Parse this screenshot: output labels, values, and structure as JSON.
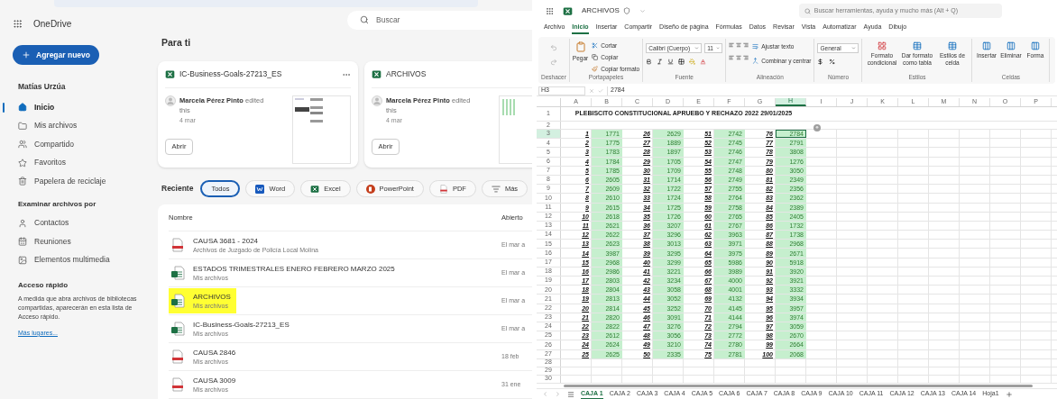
{
  "onedrive": {
    "app_name": "OneDrive",
    "new_button": "Agregar nuevo",
    "user_name": "Matías Urzúa",
    "nav": [
      {
        "label": "Inicio",
        "selected": true
      },
      {
        "label": "Mis archivos",
        "selected": false
      },
      {
        "label": "Compartido",
        "selected": false
      },
      {
        "label": "Favoritos",
        "selected": false
      },
      {
        "label": "Papelera de reciclaje",
        "selected": false
      }
    ],
    "browse_heading": "Examinar archivos por",
    "browse": [
      {
        "label": "Contactos"
      },
      {
        "label": "Reuniones"
      },
      {
        "label": "Elementos multimedia"
      }
    ],
    "quick_access": {
      "heading": "Acceso rápido",
      "text": "A medida que abra archivos de bibliotecas compartidas, aparecerán en esta lista de Acceso rápido.",
      "link": "Más lugares..."
    },
    "search": {
      "placeholder": "Buscar"
    },
    "for_you": {
      "heading": "Para ti",
      "cards": [
        {
          "title": "IC-Business-Goals-27213_ES",
          "editor": "Marcela Pérez Pinto",
          "action": "edited this",
          "date": "4 mar",
          "button": "Abrir",
          "has_menu": true
        },
        {
          "title": "ARCHIVOS",
          "editor": "Marcela Pérez Pinto",
          "action": "edited this",
          "date": "4 mar",
          "button": "Abrir",
          "has_menu": false
        }
      ]
    },
    "recent": {
      "heading": "Reciente",
      "filters": [
        {
          "label": "Todos",
          "kind": "all",
          "selected": true
        },
        {
          "label": "Word",
          "kind": "word",
          "selected": false
        },
        {
          "label": "Excel",
          "kind": "excel",
          "selected": false
        },
        {
          "label": "PowerPoint",
          "kind": "powerpoint",
          "selected": false
        },
        {
          "label": "PDF",
          "kind": "pdf",
          "selected": false
        },
        {
          "label": "Más",
          "kind": "more",
          "selected": false
        }
      ]
    },
    "files": {
      "columns": [
        "Nombre",
        "Abierto"
      ],
      "rows": [
        {
          "name": "CAUSA 3681 - 2024",
          "location": "Archivos de Juzgado de Policía Local Molina",
          "opened": "El mar a",
          "kind": "pdf",
          "highlighted": false
        },
        {
          "name": "ESTADOS TRIMESTRALES ENERO FEBRERO MARZO 2025",
          "location": "Mis archivos",
          "opened": "El mar a",
          "kind": "excel",
          "highlighted": false
        },
        {
          "name": "ARCHIVOS",
          "location": "Mis archivos",
          "opened": "El mar a",
          "kind": "excel",
          "highlighted": true
        },
        {
          "name": "IC-Business-Goals-27213_ES",
          "location": "Mis archivos",
          "opened": "El mar a",
          "kind": "excel",
          "highlighted": false
        },
        {
          "name": "CAUSA 2846",
          "location": "Mis archivos",
          "opened": "18 feb",
          "kind": "pdf",
          "highlighted": false
        },
        {
          "name": "CAUSA 3009",
          "location": "Mis archivos",
          "opened": "31 ene",
          "kind": "pdf",
          "highlighted": false
        }
      ]
    }
  },
  "excel": {
    "file_name": "ARCHIVOS",
    "search": {
      "placeholder": "Buscar herramientas, ayuda y mucho más (Alt + Q)"
    },
    "tabs": [
      {
        "label": "Archivo",
        "selected": false
      },
      {
        "label": "Inicio",
        "selected": true
      },
      {
        "label": "Insertar",
        "selected": false
      },
      {
        "label": "Compartir",
        "selected": false
      },
      {
        "label": "Diseño de página",
        "selected": false
      },
      {
        "label": "Fórmulas",
        "selected": false
      },
      {
        "label": "Datos",
        "selected": false
      },
      {
        "label": "Revisar",
        "selected": false
      },
      {
        "label": "Vista",
        "selected": false
      },
      {
        "label": "Automatizar",
        "selected": false
      },
      {
        "label": "Ayuda",
        "selected": false
      },
      {
        "label": "Dibujo",
        "selected": false
      }
    ],
    "ribbon": [
      {
        "kind": "undo",
        "label": "Deshacer"
      },
      {
        "kind": "clipboard",
        "label": "Portapapeles",
        "items": [
          "Pegar",
          "Cortar",
          "Copiar",
          "Copiar formato"
        ]
      },
      {
        "kind": "font",
        "label": "Fuente",
        "items": [
          "Calibri (Cuerpo)",
          "11"
        ]
      },
      {
        "kind": "alignment",
        "label": "Alineación",
        "items": [
          "Ajustar texto",
          "Combinar y centrar"
        ]
      },
      {
        "kind": "number",
        "label": "Número",
        "items": [
          "General"
        ]
      },
      {
        "kind": "styles",
        "label": "Estilos",
        "items": [
          "Formato condicional",
          "Dar formato como tabla",
          "Estilos de celda"
        ]
      },
      {
        "kind": "cells",
        "label": "Celdas",
        "items": [
          "Insertar",
          "Eliminar",
          "Forma"
        ]
      }
    ],
    "name_box": "H3",
    "formula": "2784",
    "columns": [
      {
        "label": "A",
        "selected": false
      },
      {
        "label": "B",
        "selected": false
      },
      {
        "label": "C",
        "selected": false
      },
      {
        "label": "D",
        "selected": false
      },
      {
        "label": "E",
        "selected": false
      },
      {
        "label": "F",
        "selected": false
      },
      {
        "label": "G",
        "selected": false
      },
      {
        "label": "H",
        "selected": true
      },
      {
        "label": "I",
        "selected": false
      },
      {
        "label": "J",
        "selected": false
      },
      {
        "label": "K",
        "selected": false
      },
      {
        "label": "L",
        "selected": false
      },
      {
        "label": "M",
        "selected": false
      },
      {
        "label": "N",
        "selected": false
      },
      {
        "label": "O",
        "selected": false
      },
      {
        "label": "P",
        "selected": false
      }
    ],
    "title_row": "1",
    "title": "PLEBISCITO CONSTITUCIONAL APRUEBO Y RECHAZO 2022 29/01/2025",
    "blank_rows": [
      "2"
    ],
    "data_rows": [
      {
        "number": "3",
        "selected": true,
        "cells": [
          "1",
          "1771",
          "26",
          "2629",
          "51",
          "2742",
          "76",
          "2784"
        ]
      },
      {
        "number": "4",
        "selected": false,
        "cells": [
          "2",
          "1775",
          "27",
          "1889",
          "52",
          "2745",
          "77",
          "2791"
        ]
      },
      {
        "number": "5",
        "selected": false,
        "cells": [
          "3",
          "1783",
          "28",
          "1897",
          "53",
          "2746",
          "78",
          "3808"
        ]
      },
      {
        "number": "6",
        "selected": false,
        "cells": [
          "4",
          "1784",
          "29",
          "1705",
          "54",
          "2747",
          "79",
          "1276"
        ]
      },
      {
        "number": "7",
        "selected": false,
        "cells": [
          "5",
          "1785",
          "30",
          "1709",
          "55",
          "2748",
          "80",
          "3050"
        ]
      },
      {
        "number": "8",
        "selected": false,
        "cells": [
          "6",
          "2605",
          "31",
          "1714",
          "56",
          "2749",
          "81",
          "2349"
        ]
      },
      {
        "number": "9",
        "selected": false,
        "cells": [
          "7",
          "2609",
          "32",
          "1722",
          "57",
          "2755",
          "82",
          "2356"
        ]
      },
      {
        "number": "10",
        "selected": false,
        "cells": [
          "8",
          "2610",
          "33",
          "1724",
          "58",
          "2764",
          "83",
          "2362"
        ]
      },
      {
        "number": "11",
        "selected": false,
        "cells": [
          "9",
          "2615",
          "34",
          "1725",
          "59",
          "2758",
          "84",
          "2389"
        ]
      },
      {
        "number": "12",
        "selected": false,
        "cells": [
          "10",
          "2618",
          "35",
          "1726",
          "60",
          "2765",
          "85",
          "2405"
        ]
      },
      {
        "number": "13",
        "selected": false,
        "cells": [
          "11",
          "2621",
          "36",
          "3207",
          "61",
          "2767",
          "86",
          "1732"
        ]
      },
      {
        "number": "14",
        "selected": false,
        "cells": [
          "12",
          "2622",
          "37",
          "3296",
          "62",
          "3963",
          "87",
          "1738"
        ]
      },
      {
        "number": "15",
        "selected": false,
        "cells": [
          "13",
          "2623",
          "38",
          "3013",
          "63",
          "3971",
          "88",
          "2968"
        ]
      },
      {
        "number": "16",
        "selected": false,
        "cells": [
          "14",
          "3987",
          "39",
          "3295",
          "64",
          "3975",
          "89",
          "2671"
        ]
      },
      {
        "number": "17",
        "selected": false,
        "cells": [
          "15",
          "2968",
          "40",
          "3299",
          "65",
          "5986",
          "90",
          "5918"
        ]
      },
      {
        "number": "18",
        "selected": false,
        "cells": [
          "16",
          "2986",
          "41",
          "3221",
          "66",
          "3989",
          "91",
          "3920"
        ]
      },
      {
        "number": "19",
        "selected": false,
        "cells": [
          "17",
          "2803",
          "42",
          "3234",
          "67",
          "4000",
          "92",
          "3921"
        ]
      },
      {
        "number": "20",
        "selected": false,
        "cells": [
          "18",
          "2804",
          "43",
          "3058",
          "68",
          "4001",
          "93",
          "3332"
        ]
      },
      {
        "number": "21",
        "selected": false,
        "cells": [
          "19",
          "2813",
          "44",
          "3052",
          "69",
          "4132",
          "94",
          "3934"
        ]
      },
      {
        "number": "22",
        "selected": false,
        "cells": [
          "20",
          "2814",
          "45",
          "3252",
          "70",
          "4145",
          "95",
          "3957"
        ]
      },
      {
        "number": "23",
        "selected": false,
        "cells": [
          "21",
          "2820",
          "46",
          "3091",
          "71",
          "4144",
          "96",
          "3974"
        ]
      },
      {
        "number": "24",
        "selected": false,
        "cells": [
          "22",
          "2822",
          "47",
          "3276",
          "72",
          "2794",
          "97",
          "3059"
        ]
      },
      {
        "number": "25",
        "selected": false,
        "cells": [
          "23",
          "2612",
          "48",
          "3056",
          "73",
          "2772",
          "98",
          "2670"
        ]
      },
      {
        "number": "26",
        "selected": false,
        "cells": [
          "24",
          "2624",
          "49",
          "3210",
          "74",
          "2780",
          "99",
          "2664"
        ]
      },
      {
        "number": "27",
        "selected": false,
        "cells": [
          "25",
          "2625",
          "50",
          "2335",
          "75",
          "2781",
          "100",
          "2068"
        ]
      }
    ],
    "extra_rows": [
      "28",
      "29",
      "30"
    ],
    "sheets": [
      {
        "label": "CAJA 1",
        "selected": true
      },
      {
        "label": "CAJA 2",
        "selected": false
      },
      {
        "label": "CAJA 3",
        "selected": false
      },
      {
        "label": "CAJA 4",
        "selected": false
      },
      {
        "label": "CAJA 5",
        "selected": false
      },
      {
        "label": "CAJA 6",
        "selected": false
      },
      {
        "label": "CAJA 7",
        "selected": false
      },
      {
        "label": "CAJA 8",
        "selected": false
      },
      {
        "label": "CAJA 9",
        "selected": false
      },
      {
        "label": "CAJA 10",
        "selected": false
      },
      {
        "label": "CAJA 11",
        "selected": false
      },
      {
        "label": "CAJA 12",
        "selected": false
      },
      {
        "label": "CAJA 13",
        "selected": false
      },
      {
        "label": "CAJA 14",
        "selected": false
      },
      {
        "label": "Hoja1",
        "selected": false
      }
    ]
  }
}
